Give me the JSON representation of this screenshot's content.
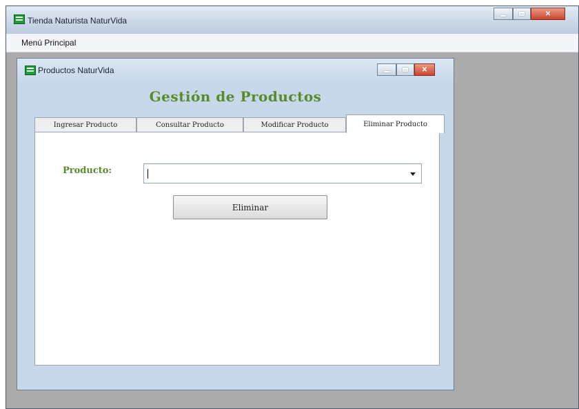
{
  "main_window": {
    "title": "Tienda Naturista NaturVida",
    "icon": "app-window-icon"
  },
  "menu": {
    "items": [
      {
        "label": "Menú Principal"
      }
    ]
  },
  "child_window": {
    "title": "Productos NaturVida",
    "icon": "app-window-icon",
    "heading": "Gestión de Productos",
    "tabs": [
      {
        "label": "Ingresar Producto",
        "active": false
      },
      {
        "label": "Consultar Producto",
        "active": false
      },
      {
        "label": "Modificar Producto",
        "active": false
      },
      {
        "label": "Eliminar Producto",
        "active": true
      }
    ],
    "form": {
      "product_label": "Producto:",
      "product_value": "",
      "delete_button": "Eliminar"
    }
  },
  "colors": {
    "accent_green": "#5a8a2a",
    "mdi_background": "#ababab",
    "close_button": "#c9442c"
  }
}
